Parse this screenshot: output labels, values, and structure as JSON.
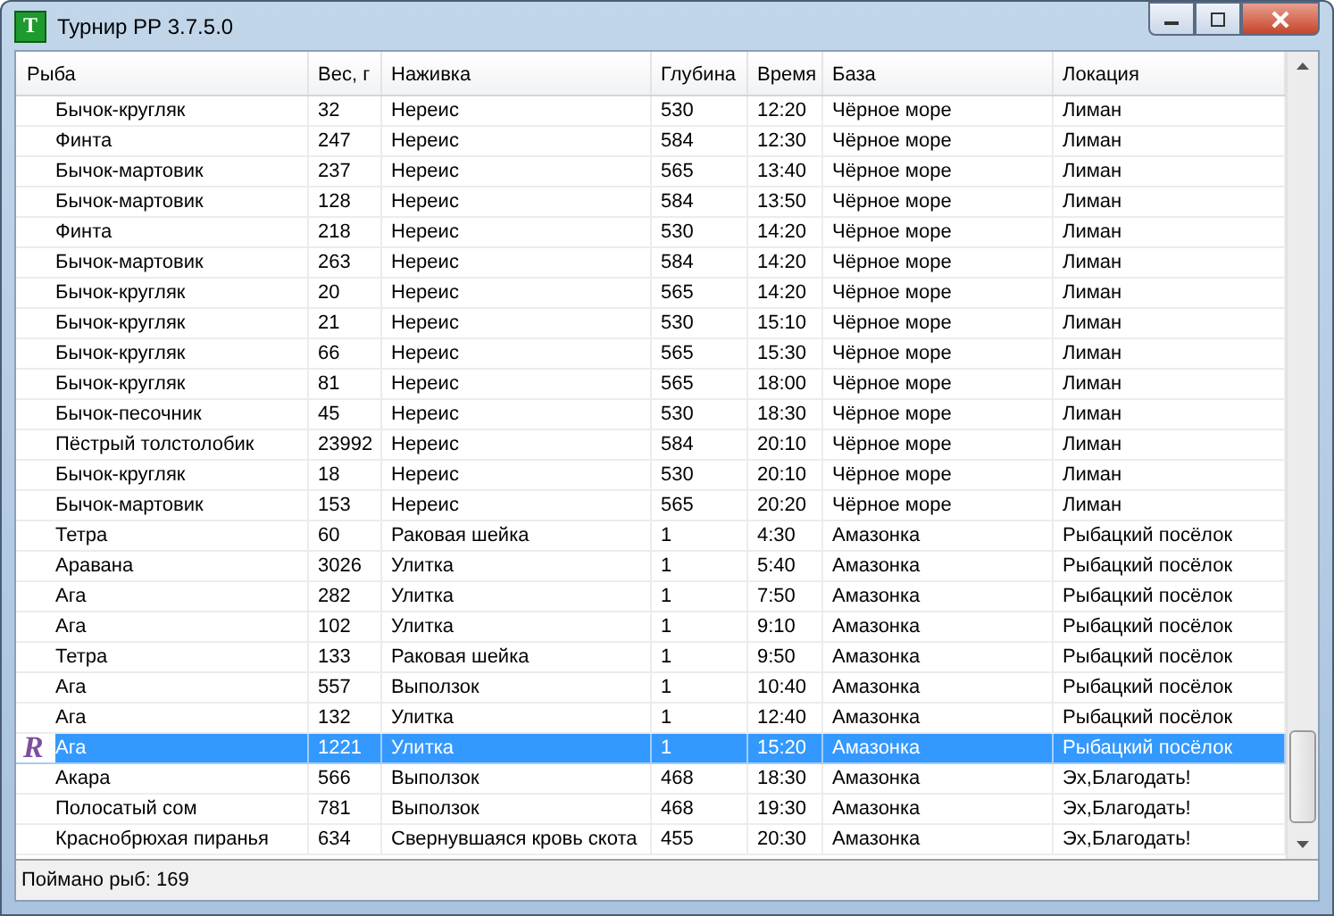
{
  "window": {
    "title": "Турнир РР 3.7.5.0",
    "app_icon": "T"
  },
  "table": {
    "columns": [
      "Рыба",
      "Вес, г",
      "Наживка",
      "Глубина",
      "Время",
      "База",
      "Локация"
    ],
    "rows": [
      {
        "cells": [
          "Бычок-кругляк",
          "32",
          "Нереис",
          "530",
          "12:20",
          "Чёрное море",
          "Лиман"
        ],
        "selected": false
      },
      {
        "cells": [
          "Финта",
          "247",
          "Нереис",
          "584",
          "12:30",
          "Чёрное море",
          "Лиман"
        ],
        "selected": false
      },
      {
        "cells": [
          "Бычок-мартовик",
          "237",
          "Нереис",
          "565",
          "13:40",
          "Чёрное море",
          "Лиман"
        ],
        "selected": false
      },
      {
        "cells": [
          "Бычок-мартовик",
          "128",
          "Нереис",
          "584",
          "13:50",
          "Чёрное море",
          "Лиман"
        ],
        "selected": false
      },
      {
        "cells": [
          "Финта",
          "218",
          "Нереис",
          "530",
          "14:20",
          "Чёрное море",
          "Лиман"
        ],
        "selected": false
      },
      {
        "cells": [
          "Бычок-мартовик",
          "263",
          "Нереис",
          "584",
          "14:20",
          "Чёрное море",
          "Лиман"
        ],
        "selected": false
      },
      {
        "cells": [
          "Бычок-кругляк",
          "20",
          "Нереис",
          "565",
          "14:20",
          "Чёрное море",
          "Лиман"
        ],
        "selected": false
      },
      {
        "cells": [
          "Бычок-кругляк",
          "21",
          "Нереис",
          "530",
          "15:10",
          "Чёрное море",
          "Лиман"
        ],
        "selected": false
      },
      {
        "cells": [
          "Бычок-кругляк",
          "66",
          "Нереис",
          "565",
          "15:30",
          "Чёрное море",
          "Лиман"
        ],
        "selected": false
      },
      {
        "cells": [
          "Бычок-кругляк",
          "81",
          "Нереис",
          "565",
          "18:00",
          "Чёрное море",
          "Лиман"
        ],
        "selected": false
      },
      {
        "cells": [
          "Бычок-песочник",
          "45",
          "Нереис",
          "530",
          "18:30",
          "Чёрное море",
          "Лиман"
        ],
        "selected": false
      },
      {
        "cells": [
          "Пёстрый толстолобик",
          "23992",
          "Нереис",
          "584",
          "20:10",
          "Чёрное море",
          "Лиман"
        ],
        "selected": false
      },
      {
        "cells": [
          "Бычок-кругляк",
          "18",
          "Нереис",
          "530",
          "20:10",
          "Чёрное море",
          "Лиман"
        ],
        "selected": false
      },
      {
        "cells": [
          "Бычок-мартовик",
          "153",
          "Нереис",
          "565",
          "20:20",
          "Чёрное море",
          "Лиман"
        ],
        "selected": false
      },
      {
        "cells": [
          "Тетра",
          "60",
          "Раковая шейка",
          "1",
          "4:30",
          "Амазонка",
          "Рыбацкий посёлок"
        ],
        "selected": false
      },
      {
        "cells": [
          "Аравана",
          "3026",
          "Улитка",
          "1",
          "5:40",
          "Амазонка",
          "Рыбацкий посёлок"
        ],
        "selected": false
      },
      {
        "cells": [
          "Ага",
          "282",
          "Улитка",
          "1",
          "7:50",
          "Амазонка",
          "Рыбацкий посёлок"
        ],
        "selected": false
      },
      {
        "cells": [
          "Ага",
          "102",
          "Улитка",
          "1",
          "9:10",
          "Амазонка",
          "Рыбацкий посёлок"
        ],
        "selected": false
      },
      {
        "cells": [
          "Тетра",
          "133",
          "Раковая шейка",
          "1",
          "9:50",
          "Амазонка",
          "Рыбацкий посёлок"
        ],
        "selected": false
      },
      {
        "cells": [
          "Ага",
          "557",
          "Выползок",
          "1",
          "10:40",
          "Амазонка",
          "Рыбацкий посёлок"
        ],
        "selected": false
      },
      {
        "cells": [
          "Ага",
          "132",
          "Улитка",
          "1",
          "12:40",
          "Амазонка",
          "Рыбацкий посёлок"
        ],
        "selected": false
      },
      {
        "cells": [
          "Ага",
          "1221",
          "Улитка",
          "1",
          "15:20",
          "Амазонка",
          "Рыбацкий посёлок"
        ],
        "selected": true,
        "marker": "R"
      },
      {
        "cells": [
          "Акара",
          "566",
          "Выползок",
          "468",
          "18:30",
          "Амазонка",
          "Эх,Благодать!"
        ],
        "selected": false
      },
      {
        "cells": [
          "Полосатый сом",
          "781",
          "Выползок",
          "468",
          "19:30",
          "Амазонка",
          "Эх,Благодать!"
        ],
        "selected": false
      },
      {
        "cells": [
          "Краснобрюхая пиранья",
          "634",
          "Свернувшаяся кровь скота",
          "455",
          "20:30",
          "Амазонка",
          "Эх,Благодать!"
        ],
        "selected": false
      }
    ]
  },
  "status_bar": "Поймано рыб: 169"
}
